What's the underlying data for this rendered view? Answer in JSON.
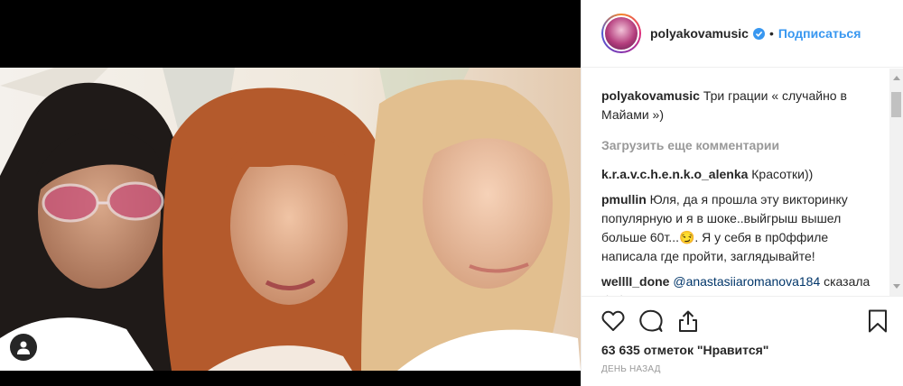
{
  "post": {
    "username": "polyakovamusic",
    "separator": "•",
    "follow_label": "Подписаться"
  },
  "caption": {
    "username": "polyakovamusic",
    "text": "Три грации « случайно в Майами »)"
  },
  "load_more_label": "Загрузить еще комментарии",
  "comments": [
    {
      "username": "k.r.a.v.c.h.e.n.k.o_alenka",
      "text": "Красотки))"
    },
    {
      "username": "pmullin",
      "text": "Юля, да я прошла эту викторинку популярную и я в шоке..выйгрыш вышел больше 60т...😏. Я у себя в пр0ффиле написала где пройти, заглядывайте!"
    },
    {
      "username": "welllI_done",
      "mention": "@anastasiiaromanova184",
      "text": "сказала бабица с поросячьим носом.Че"
    }
  ],
  "likes_label": "63 635 отметок \"Нравится\"",
  "time_label": "ДЕНЬ НАЗАД",
  "icons": {
    "like": "heart-icon",
    "comment": "comment-icon",
    "share": "share-icon",
    "save": "bookmark-icon",
    "tag": "user-icon",
    "verified": "verified-badge-icon"
  },
  "colors": {
    "link": "#3897f0",
    "mention": "#003569",
    "muted": "#999999",
    "text": "#262626"
  }
}
